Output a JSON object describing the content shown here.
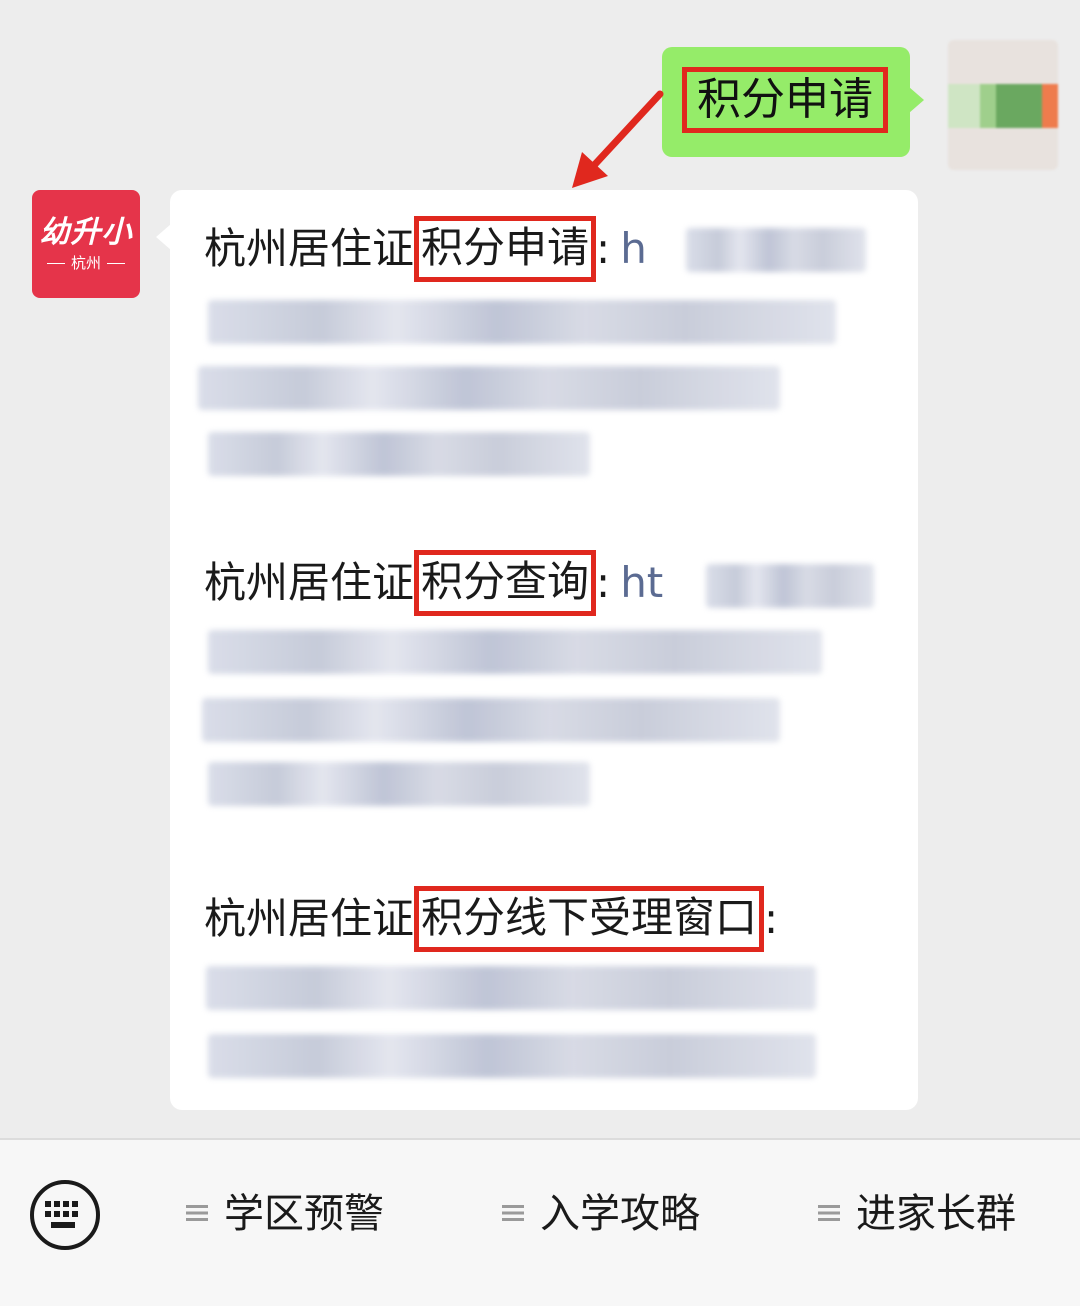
{
  "chat": {
    "outgoing_message": "积分申请",
    "messages": [
      {
        "prefix": "杭州居住证",
        "highlight": "积分申请",
        "colon": ":",
        "url": "h"
      },
      {
        "prefix": "杭州居住证",
        "highlight": "积分查询",
        "colon": ":",
        "url": "ht"
      },
      {
        "prefix": "杭州居住证",
        "highlight": "积分线下受理窗口",
        "colon": ":",
        "url": ""
      }
    ]
  },
  "bot_avatar": {
    "logo_main": "幼升小",
    "logo_sub": "杭州"
  },
  "menu": {
    "items": [
      {
        "label": "学区预警"
      },
      {
        "label": "入学攻略"
      },
      {
        "label": "进家长群"
      }
    ]
  },
  "colors": {
    "outgoing_bubble": "#95ec69",
    "highlight_border": "#e0281e",
    "bot_avatar": "#e5344a",
    "link": "#5b6b92"
  },
  "icons": {
    "keyboard": "keyboard-icon",
    "menu": "menu-lines-icon",
    "annotation": "red-arrow-icon"
  }
}
